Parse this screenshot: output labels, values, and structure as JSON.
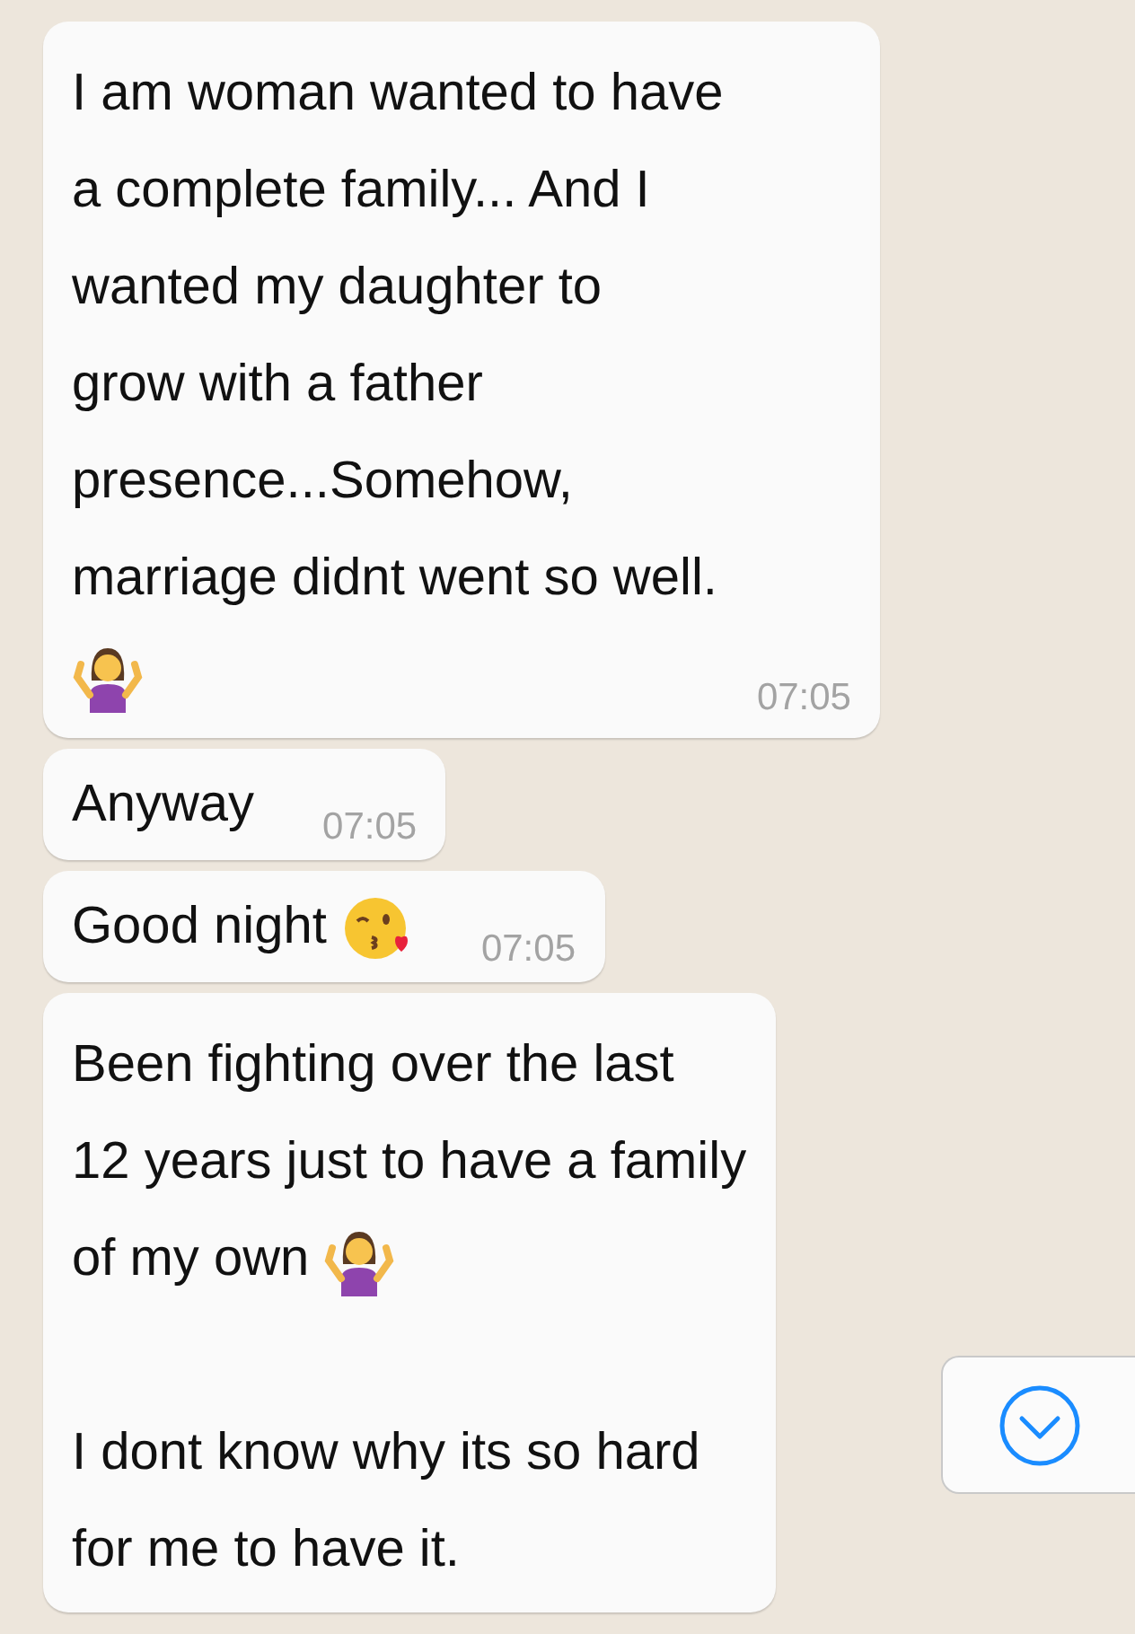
{
  "messages": [
    {
      "parts": [
        {
          "kind": "text",
          "text": "I am woman wanted to have\na complete family... And I\nwanted my daughter to\ngrow with a father\npresence...Somehow,\nmarriage didnt went so well.\n"
        },
        {
          "kind": "shrug"
        }
      ],
      "time": "07:05"
    },
    {
      "parts": [
        {
          "kind": "text",
          "text": "Anyway"
        }
      ],
      "time": "07:05"
    },
    {
      "parts": [
        {
          "kind": "text",
          "text": "Good night "
        },
        {
          "kind": "kiss"
        }
      ],
      "time": "07:05"
    },
    {
      "parts": [
        {
          "kind": "text",
          "text": "Been fighting over the last\n12 years just to have a family\n"
        },
        {
          "kind": "text",
          "text": "of my own "
        },
        {
          "kind": "shrug"
        },
        {
          "kind": "text",
          "text": "\n\nI dont know why its so hard\nfor me to have it."
        }
      ]
    }
  ]
}
